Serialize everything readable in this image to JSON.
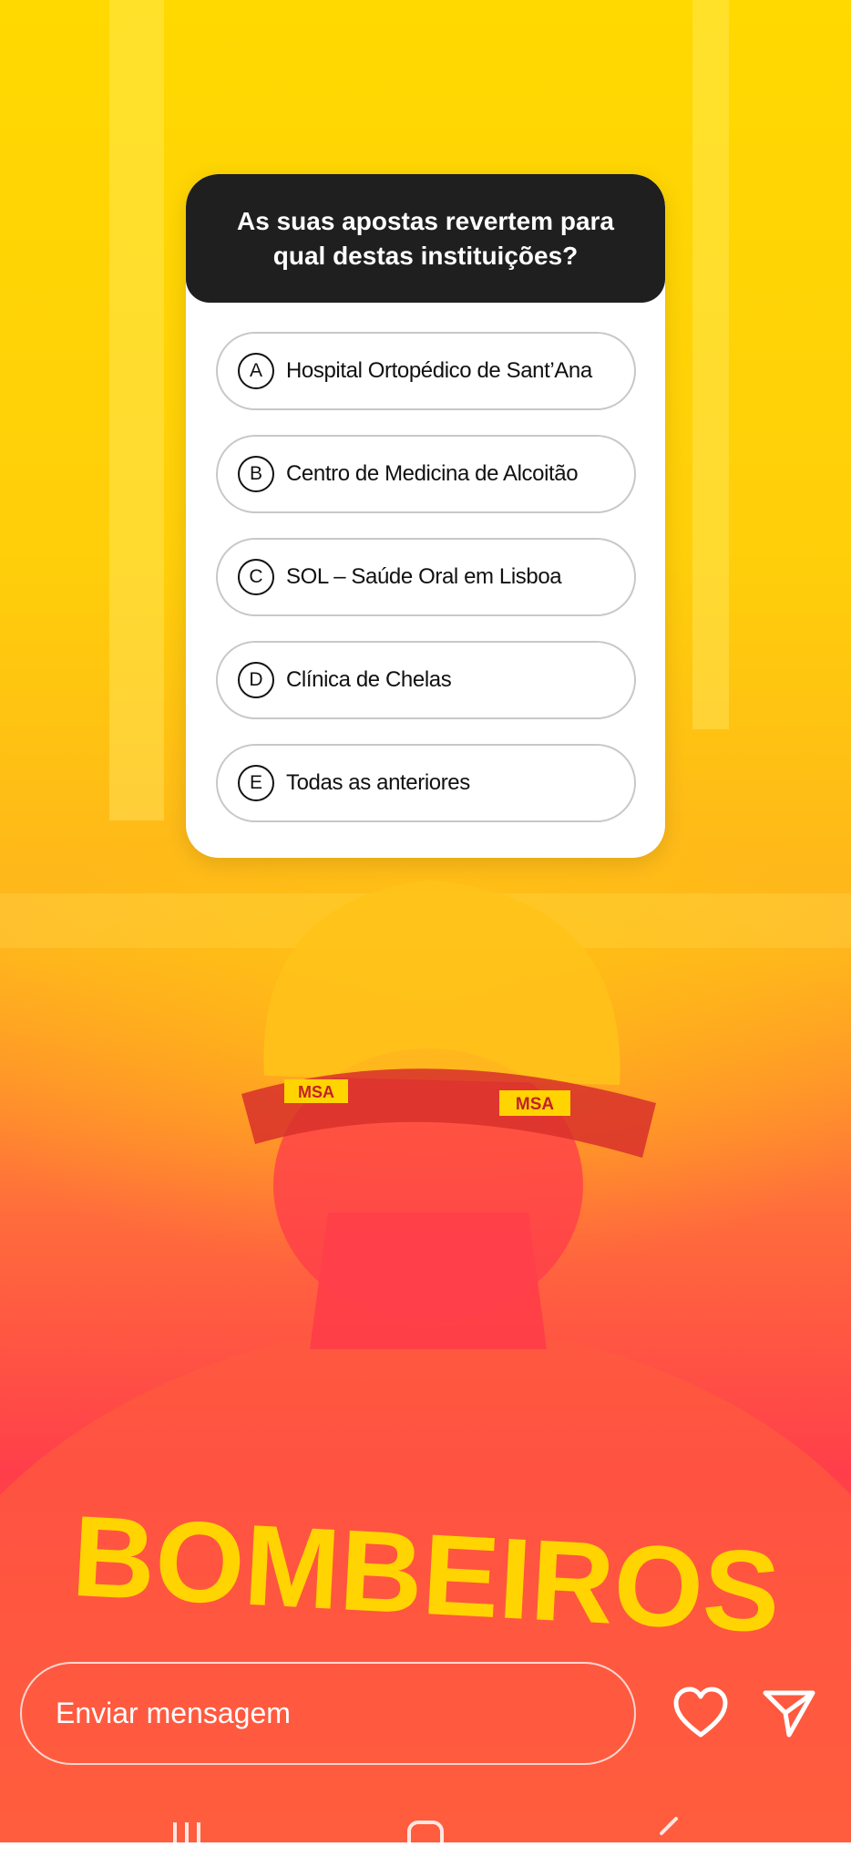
{
  "poll": {
    "question": "As suas apostas revertem para qual destas instituições?",
    "options": [
      {
        "letter": "A",
        "label": "Hospital Ortopédico de Sant’Ana"
      },
      {
        "letter": "B",
        "label": "Centro de Medicina de Alcoitão"
      },
      {
        "letter": "C",
        "label": "SOL – Saúde Oral em Lisboa"
      },
      {
        "letter": "D",
        "label": "Clínica de Chelas"
      },
      {
        "letter": "E",
        "label": "Todas as anteriores"
      }
    ]
  },
  "background": {
    "helmet_brand": "MSA",
    "jacket_text": "BOMBEIROS",
    "colors": {
      "yellow": "#ffd900",
      "orange": "#ff8a2a",
      "red": "#ff3e4a"
    }
  },
  "reply": {
    "placeholder": "Enviar mensagem"
  },
  "icons": {
    "like": "heart-icon",
    "send": "send-icon",
    "nav_recents": "recents-icon",
    "nav_home": "home-icon",
    "nav_back": "back-icon"
  }
}
